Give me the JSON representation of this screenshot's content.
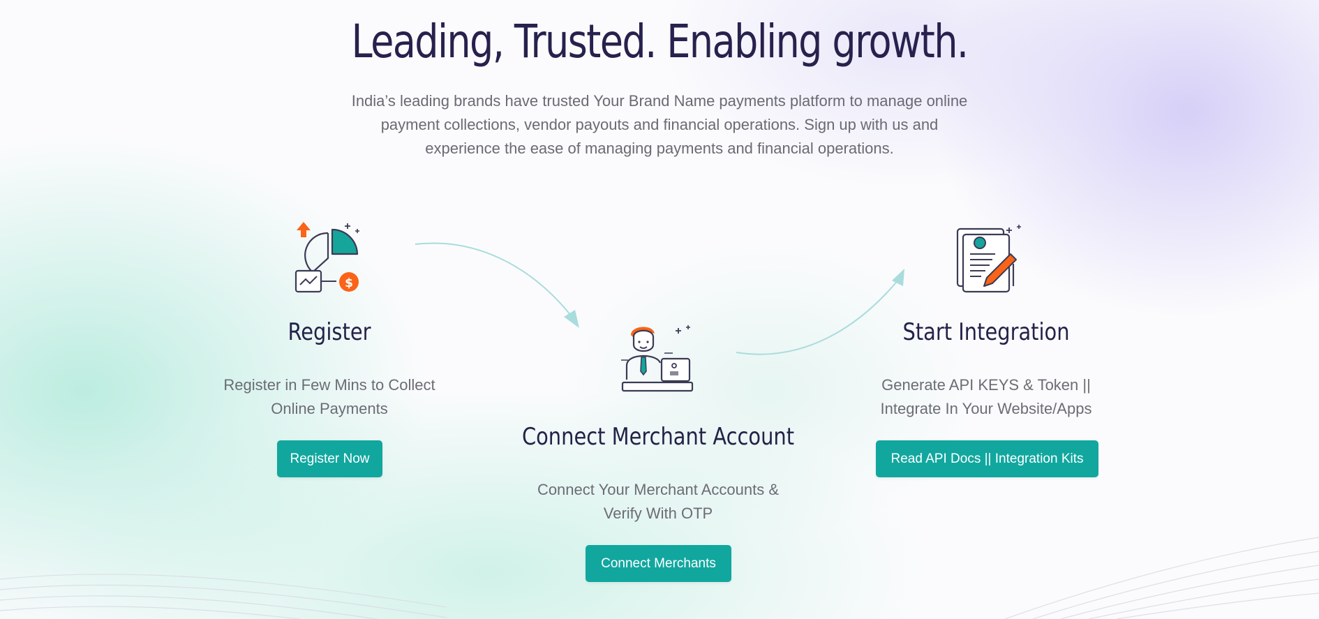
{
  "hero": {
    "title": "Leading, Trusted. Enabling growth.",
    "description": "India’s leading brands have trusted Your Brand Name payments platform to manage online payment collections, vendor payouts and financial operations. Sign up with us and experience the ease of managing payments and financial operations."
  },
  "steps": [
    {
      "icon": "analytics-chart-icon",
      "title": "Register",
      "description": "Register in Few Mins to Collect Online Payments",
      "button": "Register Now"
    },
    {
      "icon": "merchant-person-icon",
      "title": "Connect Merchant Account",
      "description": "Connect Your Merchant Accounts & Verify With OTP",
      "button": "Connect Merchants"
    },
    {
      "icon": "document-signing-icon",
      "title": "Start Integration",
      "description": "Generate API KEYS & Token || Integrate In Your Website/Apps",
      "button": "Read API Docs || Integration Kits"
    }
  ],
  "colors": {
    "accent": "#11a79f",
    "heading": "#26224d",
    "icon_orange": "#fa6418",
    "icon_teal": "#16a59b",
    "arrow": "#a9dcdc"
  }
}
